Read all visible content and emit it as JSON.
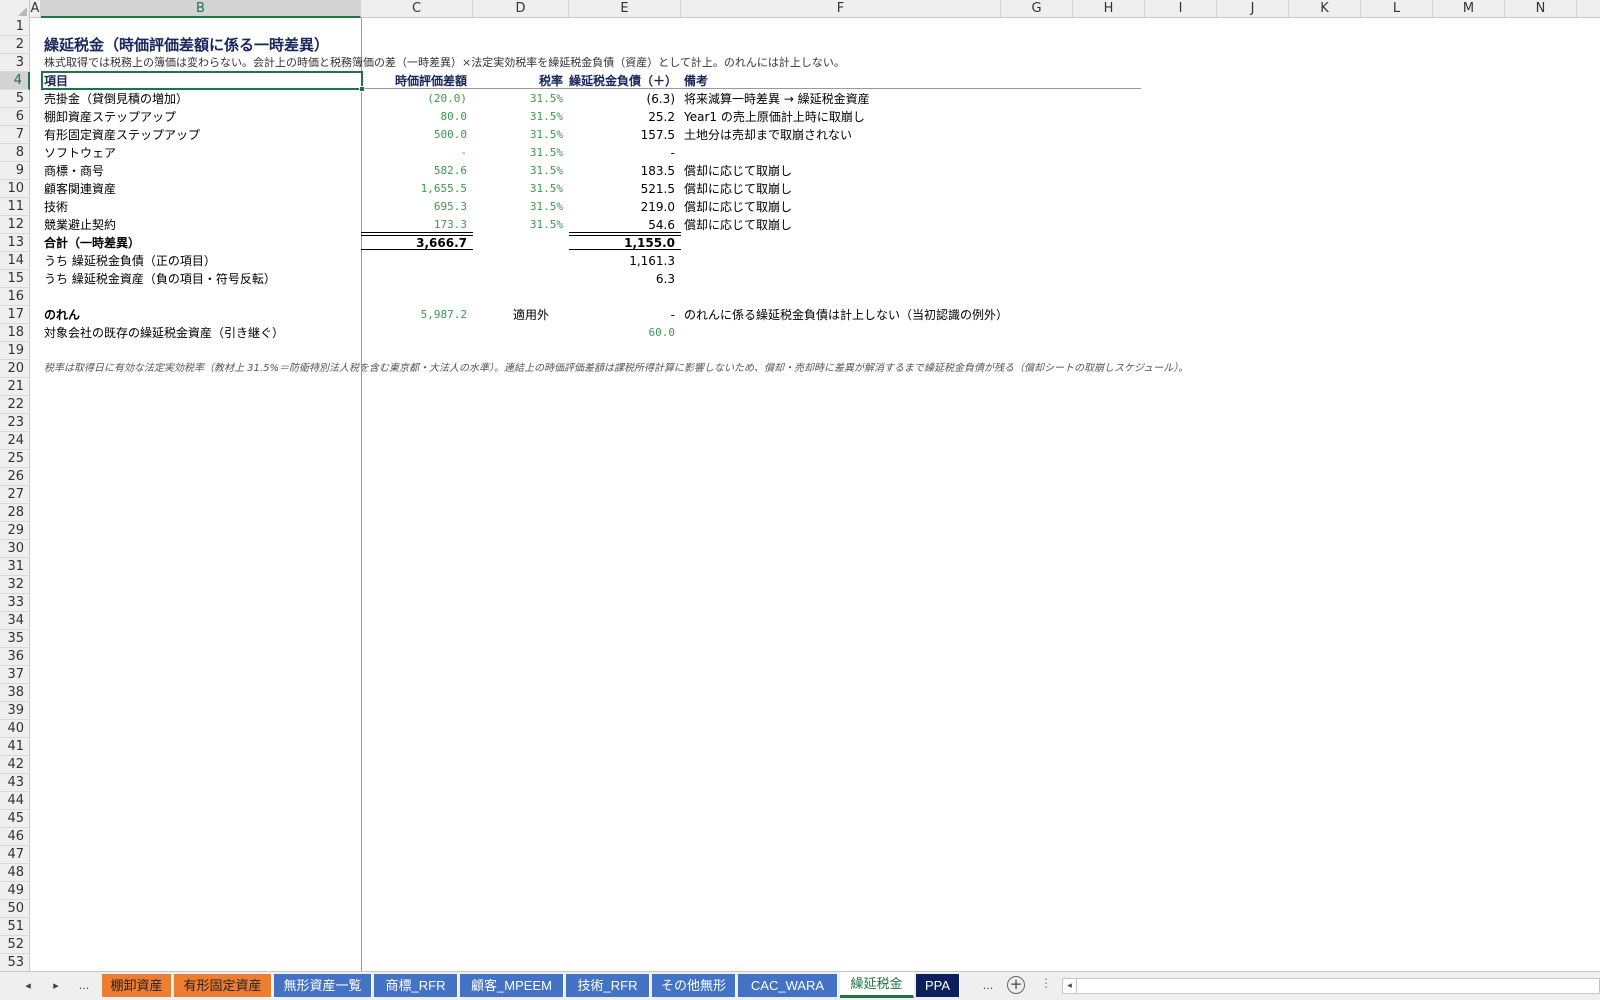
{
  "columns": [
    {
      "id": "A",
      "w": 11
    },
    {
      "id": "B",
      "w": 320
    },
    {
      "id": "C",
      "w": 112
    },
    {
      "id": "D",
      "w": 96
    },
    {
      "id": "E",
      "w": 112
    },
    {
      "id": "F",
      "w": 320
    },
    {
      "id": "G",
      "w": 72
    },
    {
      "id": "H",
      "w": 72
    },
    {
      "id": "I",
      "w": 72
    },
    {
      "id": "J",
      "w": 72
    },
    {
      "id": "K",
      "w": 72
    },
    {
      "id": "L",
      "w": 72
    },
    {
      "id": "M",
      "w": 72
    },
    {
      "id": "N",
      "w": 72
    }
  ],
  "selected_column": "B",
  "selected_row": 4,
  "row_count": 53,
  "sheet": {
    "title": "繰延税金（時価評価差額に係る一時差異）",
    "subtitle": "株式取得では税務上の簿価は変わらない。会計上の時価と税務簿価の差（一時差異）×法定実効税率を繰延税金負債（資産）として計上。のれんには計上しない。",
    "headers": {
      "item": "項目",
      "fv_diff": "時価評価差額",
      "tax_rate": "税率",
      "dtl_dta": "繰延税金負債（＋）／資産（－）",
      "remarks": "備考"
    },
    "rows": [
      {
        "item": "売掛金（貸倒見積の増加）",
        "fv": "(20.0)",
        "rate": "31.5%",
        "tax": "(6.3)",
        "note": "将来減算一時差異 → 繰延税金資産"
      },
      {
        "item": "棚卸資産ステップアップ",
        "fv": "80.0",
        "rate": "31.5%",
        "tax": "25.2",
        "note": "Year1 の売上原価計上時に取崩し"
      },
      {
        "item": "有形固定資産ステップアップ",
        "fv": "500.0",
        "rate": "31.5%",
        "tax": "157.5",
        "note": "土地分は売却まで取崩されない"
      },
      {
        "item": "ソフトウェア",
        "fv": "-",
        "rate": "31.5%",
        "tax": "-",
        "note": ""
      },
      {
        "item": "商標・商号",
        "fv": "582.6",
        "rate": "31.5%",
        "tax": "183.5",
        "note": "償却に応じて取崩し"
      },
      {
        "item": "顧客関連資産",
        "fv": "1,655.5",
        "rate": "31.5%",
        "tax": "521.5",
        "note": "償却に応じて取崩し"
      },
      {
        "item": "技術",
        "fv": "695.3",
        "rate": "31.5%",
        "tax": "219.0",
        "note": "償却に応じて取崩し"
      },
      {
        "item": "競業避止契約",
        "fv": "173.3",
        "rate": "31.5%",
        "tax": "54.6",
        "note": "償却に応じて取崩し"
      }
    ],
    "total": {
      "label": "合計（一時差異）",
      "fv": "3,666.7",
      "tax": "1,155.0"
    },
    "dtl": {
      "label": "うち 繰延税金負債（正の項目）",
      "tax": "1,161.3"
    },
    "dta": {
      "label": "うち 繰延税金資産（負の項目・符号反転）",
      "tax": "6.3"
    },
    "goodwill": {
      "label": "のれん",
      "fv": "5,987.2",
      "rate": "適用外",
      "tax": "-",
      "note": "のれんに係る繰延税金負債は計上しない（当初認識の例外）"
    },
    "existing_dta": {
      "label": "対象会社の既存の繰延税金資産（引き継ぐ）",
      "tax": "60.0"
    },
    "footnote": "税率は取得日に有効な法定実効税率（教材上 31.5%＝防衛特別法人税を含む東京都・大法人の水準）。連結上の時価評価差額は課税所得計算に影響しないため、償却・売却時に差異が解消するまで繰延税金負債が残る（償却シートの取崩しスケジュール）。"
  },
  "tabs": {
    "nav_prev": "◂",
    "nav_next": "▸",
    "ellipsis": "...",
    "items": [
      {
        "label": "棚卸資産",
        "color": "orange"
      },
      {
        "label": "有形固定資産",
        "color": "orange"
      },
      {
        "label": "無形資産一覧",
        "color": "blue"
      },
      {
        "label": "商標_RFR",
        "color": "blue"
      },
      {
        "label": "顧客_MPEEM",
        "color": "blue"
      },
      {
        "label": "技術_RFR",
        "color": "blue"
      },
      {
        "label": "その他無形",
        "color": "blue"
      },
      {
        "label": "CAC_WARA",
        "color": "blue"
      },
      {
        "label": "繰延税金",
        "color": "active"
      },
      {
        "label": "PPA",
        "color": "navy"
      }
    ],
    "add": "+",
    "vdots": "⋮",
    "scroll_left": "◂"
  }
}
